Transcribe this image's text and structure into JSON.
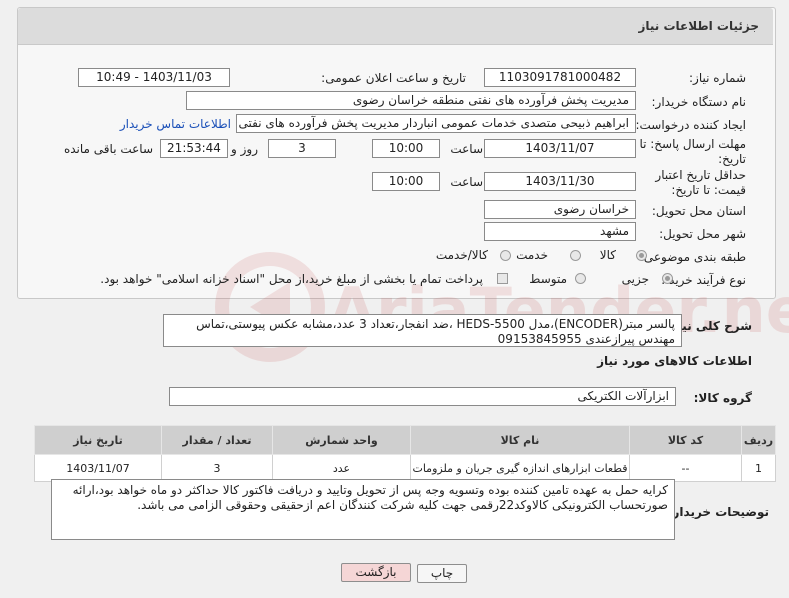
{
  "header": {
    "title": "جزئیات اطلاعات نیاز"
  },
  "labels": {
    "need_number": "شماره نیاز:",
    "announce_datetime": "تاریخ و ساعت اعلان عمومی:",
    "buyer_org": "نام دستگاه خریدار:",
    "requester": "ایجاد کننده درخواست:",
    "reply_deadline": "مهلت ارسال پاسخ: تا تاریخ:",
    "price_validity": "حداقل تاریخ اعتبار قیمت: تا تاریخ:",
    "time": "ساعت",
    "days_and": "روز و",
    "hours_left": "ساعت باقی مانده",
    "delivery_province": "استان محل تحویل:",
    "delivery_city": "شهر محل تحویل:",
    "category": "طبقه بندی موضوعی:",
    "purchase_type": "نوع فرآیند خرید :",
    "description": "شرح کلی نیاز:",
    "goods_info": "اطلاعات کالاهای مورد نیاز",
    "goods_group": "گروه کالا:",
    "buyer_notes": "توضیحات خریدار:"
  },
  "values": {
    "need_number": "1103091781000482",
    "announce_datetime": "1403/11/03 - 10:49",
    "buyer_org": "مدیریت پخش فرآورده های نفتی منطقه خراسان رضوی",
    "requester": "ابراهیم ذبیحی متصدی خدمات عمومی انباردار مدیریت پخش فرآورده های نفتی منطقه",
    "contact_link": "اطلاعات تماس خریدار",
    "reply_date": "1403/11/07",
    "reply_time": "10:00",
    "days": "3",
    "remaining": "21:53:44",
    "validity_date": "1403/11/30",
    "validity_time": "10:00",
    "province": "خراسان رضوی",
    "city": "مشهد",
    "category_options": [
      "کالا",
      "خدمت",
      "کالا/خدمت"
    ],
    "purchase_options": [
      "جزیی",
      "متوسط"
    ],
    "payment_note": "پرداخت تمام یا بخشی از مبلغ خرید،از محل \"اسناد خزانه اسلامی\" خواهد بود.",
    "description": "پالسر مبتر(ENCODER)،مدل HEDS-5500 ،ضد انفجار،تعداد 3 عدد،مشابه عکس پیوستی،تماس مهندس پیرازعندی 09153845955",
    "goods_group": "ابزارآلات الکتریکی",
    "buyer_notes": "کرایه حمل به عهده تامین کننده بوده وتسویه وجه پس از تحویل وتایید و دریافت فاکتور کالا حداکثر دو ماه خواهد بود،ارائه صورتحساب الکترونیکی کالاوکد22رقمی جهت کلیه شرکت کنندگان اعم ازحقیقی وحقوقی الزامی می باشد."
  },
  "table": {
    "headers": [
      "ردیف",
      "کد کالا",
      "نام کالا",
      "واحد شمارش",
      "تعداد / مقدار",
      "تاریخ نیاز"
    ],
    "rows": [
      [
        "1",
        "--",
        "قطعات ابزارهای اندازه گیری جریان و ملزومات",
        "عدد",
        "3",
        "1403/11/07"
      ]
    ]
  },
  "buttons": {
    "print": "چاپ",
    "back": "بازگشت"
  },
  "watermark": "AriaTender.neT",
  "colors": {
    "link": "#1a4fb8",
    "back_button_bg": "#f5d6d6",
    "watermark": "#c23b3b"
  }
}
